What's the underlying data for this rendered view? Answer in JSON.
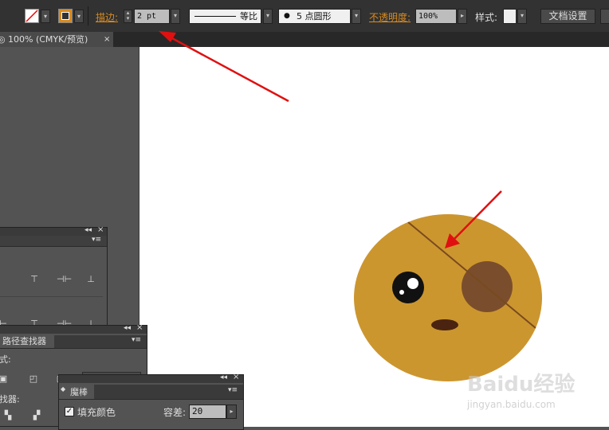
{
  "control_bar": {
    "stroke_label": "描边:",
    "stroke_weight": "2 pt",
    "profile_label": "等比",
    "brush_label": "5 点圆形",
    "opacity_label": "不透明度:",
    "opacity_value": "100%",
    "style_label": "样式:",
    "doc_settings_label": "文档设置"
  },
  "document_tab": {
    "title": "100% (CMYK/预览)",
    "close_glyph": "×"
  },
  "pathfinder_panel": {
    "tab_label": "路径查找器",
    "shape_modes_label": "式:",
    "pathfinders_label": "找器:"
  },
  "magic_wand_panel": {
    "tab_label": "魔棒",
    "fill_color_label": "填充颜色",
    "fill_color_checked": true,
    "tolerance_label": "容差:",
    "tolerance_value": "20"
  },
  "watermark": {
    "brand": "Baidu经验",
    "url": "jingyan.baidu.com"
  },
  "colors": {
    "face": "#cc962f",
    "patch": "#7a4e2c",
    "string": "#7a4a1f",
    "mouth": "#4a2410",
    "accent_orange": "#d98b1f",
    "arrow": "#e01010"
  },
  "icons": {
    "collapse": "◂◂",
    "close": "×",
    "menu": "▾≡"
  }
}
